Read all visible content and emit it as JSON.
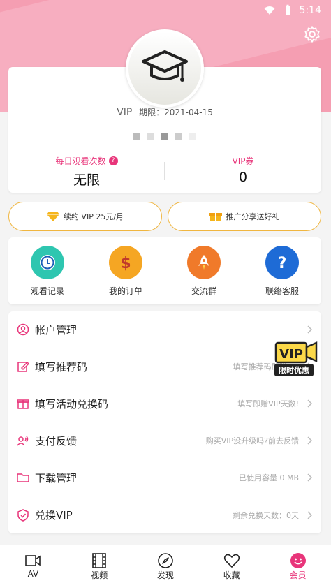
{
  "status_bar": {
    "time": "5:14",
    "wifi_icon": "wifi-icon",
    "battery_icon": "battery-icon"
  },
  "header": {
    "settings_icon": "gear-icon",
    "avatar_icon": "graduation-cap-icon"
  },
  "profile": {
    "vip_label": "VIP",
    "expiry_label": "期限：",
    "expiry_date": "2021-04-15",
    "daily_views_label": "每日观看次数",
    "daily_views_value": "无限",
    "coupon_label": "VIP券",
    "coupon_value": "0"
  },
  "promos": {
    "renew": "续约 VIP 25元/月",
    "share": "推广分享送好礼"
  },
  "quick_actions": [
    {
      "label": "观看记录",
      "icon": "clock-icon",
      "color": "#2ec6b0"
    },
    {
      "label": "我的订单",
      "icon": "dollar-icon",
      "color": "#f5a623"
    },
    {
      "label": "交流群",
      "icon": "rocket-icon",
      "color": "#f07a2a"
    },
    {
      "label": "联络客服",
      "icon": "question-icon",
      "color": "#1e6bd6"
    }
  ],
  "menu": [
    {
      "title": "帐户管理",
      "hint": ""
    },
    {
      "title": "填写推荐码",
      "hint": "填写推荐码即赠VIP"
    },
    {
      "title": "填写活动兑换码",
      "hint": "填写即赠VIP天数!"
    },
    {
      "title": "支付反馈",
      "hint": "购买VIP没升级吗?前去反馈"
    },
    {
      "title": "下载管理",
      "hint": "已使用容量 0 MB"
    },
    {
      "title": "兑换VIP",
      "hint": "剩余兑换天数：0天"
    }
  ],
  "sticker": {
    "top": "VIP",
    "bottom": "限时优惠"
  },
  "tabs": [
    {
      "label": "AV",
      "icon": "video-camera-icon"
    },
    {
      "label": "视频",
      "icon": "film-icon"
    },
    {
      "label": "发现",
      "icon": "compass-icon"
    },
    {
      "label": "收藏",
      "icon": "heart-icon"
    },
    {
      "label": "会员",
      "icon": "smiley-icon"
    }
  ],
  "colors": {
    "accent": "#e8357a",
    "hero": "#f59eb2",
    "promo_border": "#f0b640"
  }
}
